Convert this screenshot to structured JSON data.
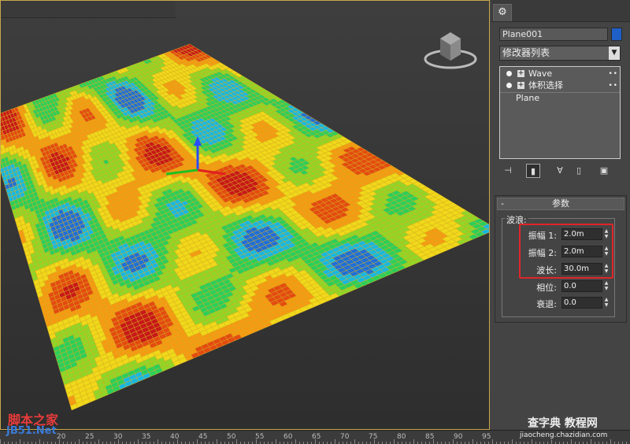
{
  "viewport": {
    "label": "",
    "mesh_colors": [
      "#1f6fd8",
      "#18b8e0",
      "#2bcf5a",
      "#8fd628",
      "#f0d81a",
      "#f59a12",
      "#e44b10",
      "#c81818"
    ]
  },
  "panel": {
    "object_name": "Plane001",
    "object_color": "#1f5fc8",
    "modifier_list": "修改器列表",
    "stack": [
      {
        "label": "Wave",
        "expand": "+",
        "dots": "• •"
      },
      {
        "label": "体积选择",
        "expand": "+",
        "dots": "• •"
      },
      {
        "label": "Plane",
        "expand": "",
        "dots": ""
      }
    ],
    "rollout": {
      "minus": "-",
      "title": "参数",
      "group_title": "波浪:",
      "params": [
        {
          "label": "振幅 1:",
          "value": "2.0m"
        },
        {
          "label": "振幅 2:",
          "value": "2.0m"
        },
        {
          "label": "波长:",
          "value": "30.0m"
        },
        {
          "label": "相位:",
          "value": "0.0"
        },
        {
          "label": "衰退:",
          "value": "0.0"
        }
      ]
    }
  },
  "ruler": {
    "labels": [
      "20",
      "25",
      "30",
      "35",
      "40",
      "45",
      "50",
      "55",
      "60",
      "65",
      "70",
      "75",
      "80",
      "85",
      "90",
      "95"
    ]
  },
  "watermarks": {
    "left_top": "脚本之家",
    "left_bottom": "JB51.Net",
    "right_top": "查字典 教程网",
    "right_bottom": "jiaocheng.chazidian.com"
  }
}
